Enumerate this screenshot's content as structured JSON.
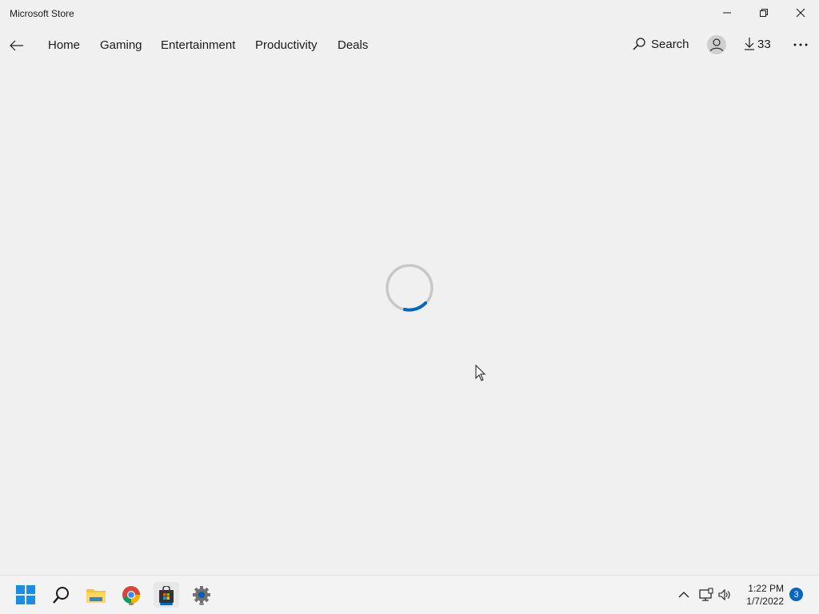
{
  "window": {
    "title": "Microsoft Store"
  },
  "nav": {
    "back_icon": "arrow-left-icon",
    "items": [
      {
        "label": "Home"
      },
      {
        "label": "Gaming"
      },
      {
        "label": "Entertainment"
      },
      {
        "label": "Productivity"
      },
      {
        "label": "Deals"
      }
    ],
    "search_label": "Search",
    "downloads_count": "33",
    "more_icon": "ellipsis-icon"
  },
  "content": {
    "state": "loading",
    "spinner_color": "#0067c0"
  },
  "taskbar": {
    "apps": [
      "start",
      "search",
      "file-explorer",
      "chrome",
      "microsoft-store",
      "settings"
    ],
    "active_app": "microsoft-store",
    "time": "1:22 PM",
    "date": "1/7/2022",
    "notification_count": "3",
    "accent": "#0067c0"
  }
}
